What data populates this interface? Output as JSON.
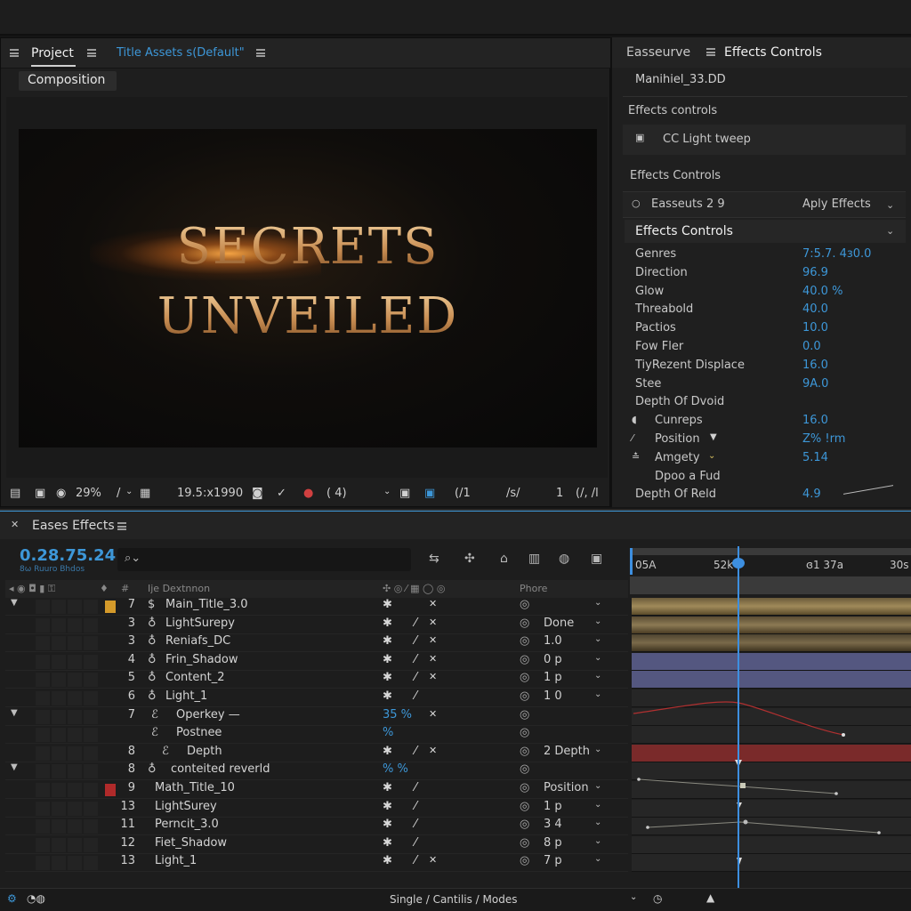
{
  "project_panel": {
    "tab_project": "Project",
    "tab_title_assets": "Title  Assets s(Default\"",
    "composition_button": "Composition",
    "viewer_title_line1": "SECRETS",
    "viewer_title_line2": "UNVEILED",
    "viewer_bar": {
      "zoom": "29%",
      "slash": "/",
      "resolution": "19.5:x1990",
      "channel": "( 4)",
      "field1": "(/1",
      "field2": "/s/",
      "field3": "1",
      "field4": "(/, /l"
    }
  },
  "effects_panel": {
    "tab_easseurve": "Easseurve",
    "tab_effects_controls": "Effects Controls",
    "layer_name": "Manihiel_33.DD",
    "section_effects_controls_lower": "Effects controls",
    "cc_item": "CC Light tweep",
    "section_effects_controls": "Effects Controls",
    "easseuts": "Easseuts 2 9",
    "apply_effects": "Aply Effects",
    "effects_controls_header": "Effects Controls",
    "properties": [
      {
        "name": "Genres",
        "value": "7:5.7. 4ɜ0.0"
      },
      {
        "name": "Direction",
        "value": "96.9"
      },
      {
        "name": "Glow",
        "value": "40.0 %"
      },
      {
        "name": "Threabold",
        "value": "40.0"
      },
      {
        "name": "Pactios",
        "value": "10.0"
      },
      {
        "name": "Fow Fler",
        "value": "0.0"
      },
      {
        "name": "TiyRezent Displace",
        "value": "16.0"
      },
      {
        "name": "Stee",
        "value": "9A.0"
      },
      {
        "name": "Depth Of Dvoid",
        "value": ""
      },
      {
        "name": "Cunreps",
        "value": "16.0"
      },
      {
        "name": "Position",
        "value": "Z% !rm"
      },
      {
        "name": "Amgety",
        "value": "5.14"
      },
      {
        "name": "Dpoo a Fud",
        "value": ""
      },
      {
        "name": "Depth Of Reld",
        "value": "4.9"
      }
    ]
  },
  "timeline": {
    "tab": "Eases Effects",
    "timecode": "0.28.75.24",
    "timecode_sub": "8ω  Ruuro Bhdos",
    "search_placeholder": "",
    "column_source": "Ije Dextnnon",
    "column_parent": "Phore",
    "ruler": [
      "05A",
      "52k",
      "ɞ1 37a",
      "30s"
    ],
    "layers": [
      {
        "num": "7",
        "name": "Main_Title_3.0",
        "parent": "",
        "tri": "▼"
      },
      {
        "num": "3",
        "name": "LightSurepy",
        "parent": "Done",
        "tri": ""
      },
      {
        "num": "3",
        "name": "Reniafs_DC",
        "parent": "1.0",
        "tri": ""
      },
      {
        "num": "4",
        "name": "Frin_Shadow",
        "parent": "0 p",
        "tri": ""
      },
      {
        "num": "5",
        "name": "Content_2",
        "parent": "1 p",
        "tri": ""
      },
      {
        "num": "6",
        "name": "Light_1",
        "parent": "1 0",
        "tri": ""
      },
      {
        "num": "7",
        "name": "Operkey —",
        "parent": "",
        "tri": "▼"
      },
      {
        "num": "",
        "name": "Postnee",
        "parent": "",
        "tri": ""
      },
      {
        "num": "8",
        "name": "Depth",
        "parent": "2 Depth",
        "tri": ""
      },
      {
        "num": "8",
        "name": "conteited reverld",
        "parent": "",
        "tri": "▼"
      },
      {
        "num": "9",
        "name": "Math_Title_10",
        "parent": "Position",
        "tri": ""
      },
      {
        "num": "13",
        "name": "LightSurey",
        "parent": "1 p",
        "tri": ""
      },
      {
        "num": "11",
        "name": "Perncit_3.0",
        "parent": "3 4",
        "tri": ""
      },
      {
        "num": "12",
        "name": "Fiet_Shadow",
        "parent": "8 p",
        "tri": ""
      },
      {
        "num": "13",
        "name": "Light_1",
        "parent": "7 p",
        "tri": ""
      }
    ],
    "switch_blue_1": "35 %",
    "switch_blue_2": "%",
    "switch_blue_3": "% %"
  },
  "status_bar": {
    "modes": "Single / Cantilis  / Modes"
  },
  "colors": {
    "accent_blue": "#3d97d8",
    "track_purple": "#545780",
    "track_red": "#7a2a2a"
  }
}
